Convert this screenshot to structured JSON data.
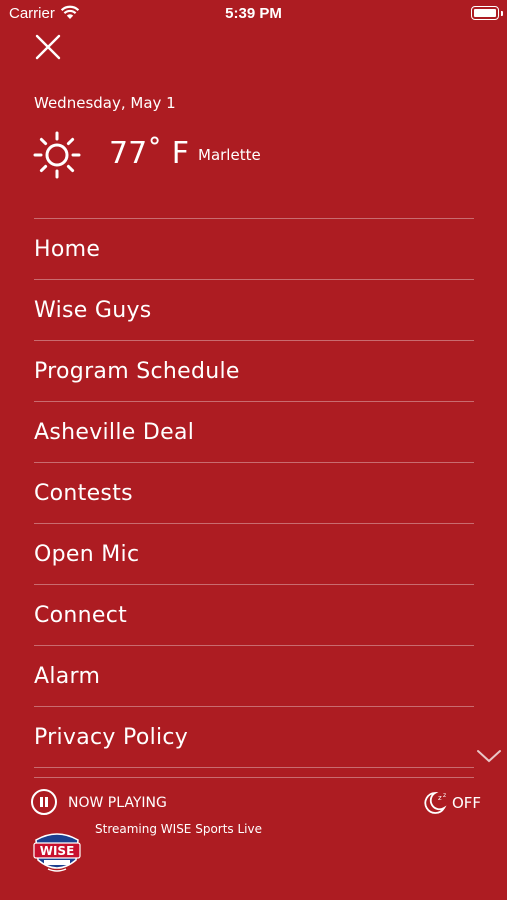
{
  "status_bar": {
    "carrier": "Carrier",
    "time": "5:39 PM"
  },
  "weather": {
    "date": "Wednesday, May 1",
    "temperature": "77˚ F",
    "location": "Marlette",
    "icon": "sun-icon"
  },
  "menu": {
    "items": [
      {
        "label": "Home"
      },
      {
        "label": "Wise Guys"
      },
      {
        "label": "Program Schedule"
      },
      {
        "label": "Asheville Deal"
      },
      {
        "label": "Contests"
      },
      {
        "label": "Open Mic"
      },
      {
        "label": "Connect"
      },
      {
        "label": "Alarm"
      },
      {
        "label": "Privacy Policy"
      }
    ]
  },
  "player": {
    "status": "NOW PLAYING",
    "stream_title": "Streaming WISE Sports Live",
    "sleep_timer": "OFF",
    "logo_text": "WISE"
  },
  "colors": {
    "background": "#ad1c22",
    "text": "#ffffff"
  }
}
